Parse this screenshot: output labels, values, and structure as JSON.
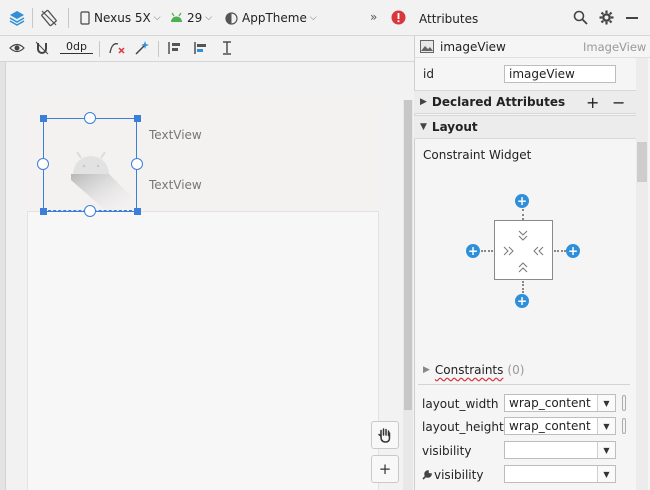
{
  "toolbar": {
    "device": "Nexus 5X",
    "api": "29",
    "theme": "AppTheme",
    "overflow": "»",
    "margin": "0dp"
  },
  "canvas": {
    "textview1": "TextView",
    "textview2": "TextView",
    "zoom_in": "+"
  },
  "panel": {
    "title": "Attributes",
    "component_name": "imageView",
    "component_type": "ImageView",
    "id_label": "id",
    "id_value": "imageView",
    "declared": "Declared Attributes",
    "layout": "Layout",
    "constraint_widget": "Constraint Widget",
    "constraints": "Constraints",
    "constraints_count": "(0)",
    "plus": "+",
    "minus": "−",
    "rows": [
      {
        "label": "layout_width",
        "value": "wrap_content"
      },
      {
        "label": "layout_height",
        "value": "wrap_content"
      },
      {
        "label": "visibility",
        "value": ""
      },
      {
        "label": "visibility",
        "value": ""
      }
    ]
  },
  "colors": {
    "accent": "#3d7fd8",
    "plus": "#2f8fd8",
    "error": "#d9363e"
  }
}
